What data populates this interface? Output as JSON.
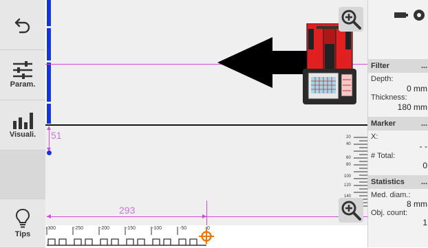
{
  "toolbar": {
    "buttons": [
      {
        "icon": "undo-icon",
        "label": ""
      },
      {
        "icon": "sliders-icon",
        "label": "Param."
      },
      {
        "icon": "bar-chart-icon",
        "label": "Visuali."
      },
      {
        "icon": "blank",
        "label": ""
      },
      {
        "icon": "lightbulb-icon",
        "label": "Tips"
      }
    ]
  },
  "scan": {
    "depth_marker_value": "51",
    "distance_value": "293",
    "ruler_ticks": [
      "-300",
      "-250",
      "-200",
      "-150",
      "-100",
      "-50",
      "0"
    ],
    "depth_scale_ticks": [
      "20",
      "40",
      "60",
      "80",
      "100",
      "120",
      "140"
    ]
  },
  "panel": {
    "filter": {
      "title": "Filter",
      "dots": "...",
      "depth_label": "Depth:",
      "depth_value": "0 mm",
      "thickness_label": "Thickness:",
      "thickness_value": "180 mm"
    },
    "marker": {
      "title": "Marker",
      "dots": "...",
      "x_label": "X:",
      "x_value": "- -",
      "total_label": "# Total:",
      "total_value": "0"
    },
    "statistics": {
      "title": "Statistics",
      "dots": "...",
      "med_label": "Med. diam.:",
      "med_value": "8 mm",
      "count_label": "Obj. count:",
      "count_value": "1"
    }
  },
  "colors": {
    "blue_bar": "#1a35d6",
    "guide_magenta": "#d24bd8",
    "cursor_orange": "#f07800",
    "device_red": "#e02020"
  }
}
